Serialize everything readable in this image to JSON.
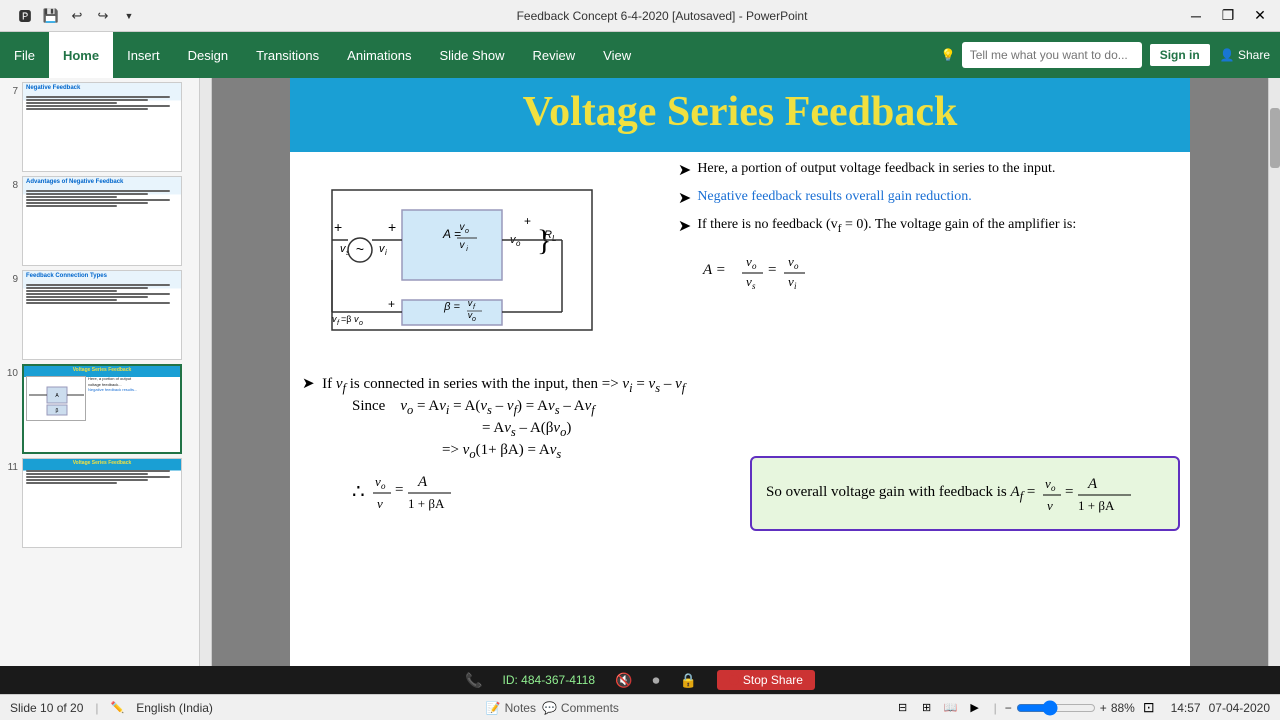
{
  "window": {
    "title": "Feedback Concept 6-4-2020 [Autosaved] - PowerPoint"
  },
  "quickaccess": {
    "save": "💾",
    "undo": "↩",
    "redo": "↪",
    "customize": "▼"
  },
  "titlebar": {
    "title": "Feedback Concept 6-4-2020 [Autosaved] - PowerPoint",
    "minimize": "─",
    "restore": "❐",
    "close": "✕"
  },
  "ribbon": {
    "tabs": [
      "File",
      "Home",
      "Insert",
      "Design",
      "Transitions",
      "Animations",
      "Slide Show",
      "Review",
      "View"
    ],
    "search_placeholder": "Tell me what you want to do...",
    "sign_in": "Sign in",
    "share": "Share"
  },
  "slides": [
    {
      "num": "7",
      "label": "Negative Feedback"
    },
    {
      "num": "8",
      "label": "Advantages of Negative Feedback"
    },
    {
      "num": "9",
      "label": "Feedback Connection Types"
    },
    {
      "num": "10",
      "label": "Voltage Series Feedback",
      "active": true
    },
    {
      "num": "11",
      "label": "Voltage Series Feedback"
    }
  ],
  "slide": {
    "title": "Voltage Series Feedback",
    "bullets": [
      {
        "text": "Here, a portion of output voltage feedback in series to the input.",
        "color": "black"
      },
      {
        "text": "Negative feedback results overall gain reduction.",
        "color": "blue"
      },
      {
        "text": "If there is no feedback (v",
        "sub": "f",
        "text2": " = 0). The voltage gain of the amplifier is:",
        "color": "black"
      }
    ],
    "formula_A": "A = v_o / v_s = v_o / v_i",
    "bottom": {
      "line1": "➤  If v_f is connected in series with the input, then => v_i = v_s – v_f",
      "line2": "Since     v_o = Av_i = A(v_s – v_f) = Av_s – Av_f",
      "line3": "= Av_s – A(βv_o)",
      "line4": "=> v_o(1+ βA) = Av_s",
      "line5": "∴    v_o / v = A / (1 + βA)"
    },
    "callout": {
      "text": "So overall voltage gain with feedback is",
      "formula": "A_f = v_o / v = A / (1 + βA)"
    }
  },
  "statusbar": {
    "slide_info": "Slide 10 of 20",
    "language": "English (India)",
    "notes_label": "Notes",
    "comments_label": "Comments",
    "zoom": "88%",
    "time": "14:57",
    "date": "07-04-2020"
  },
  "meeting": {
    "phone_icon": "📞",
    "id_label": "ID: 484-367-4118",
    "mic_icon": "🔇",
    "rec_icon": "⏺",
    "lock_icon": "🔒",
    "stop_btn": "Stop Share"
  }
}
